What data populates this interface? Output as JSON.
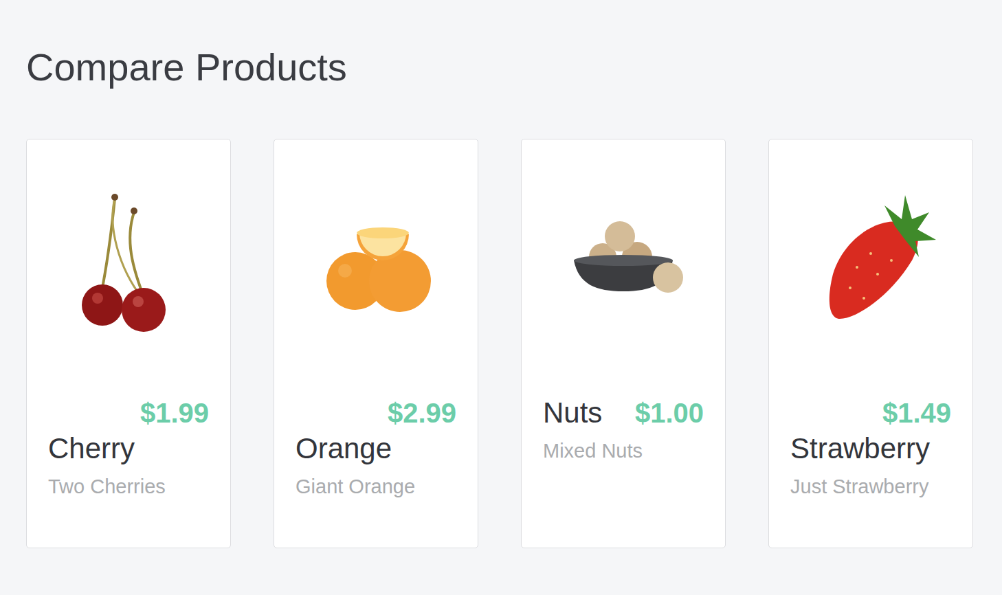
{
  "title": "Compare Products",
  "products": [
    {
      "price": "$1.99",
      "name": "Cherry",
      "subtitle": "Two Cherries"
    },
    {
      "price": "$2.99",
      "name": "Orange",
      "subtitle": "Giant Orange"
    },
    {
      "price": "$1.00",
      "name": "Nuts",
      "subtitle": "Mixed Nuts"
    },
    {
      "price": "$1.49",
      "name": "Strawberry",
      "subtitle": "Just Strawberry"
    }
  ]
}
